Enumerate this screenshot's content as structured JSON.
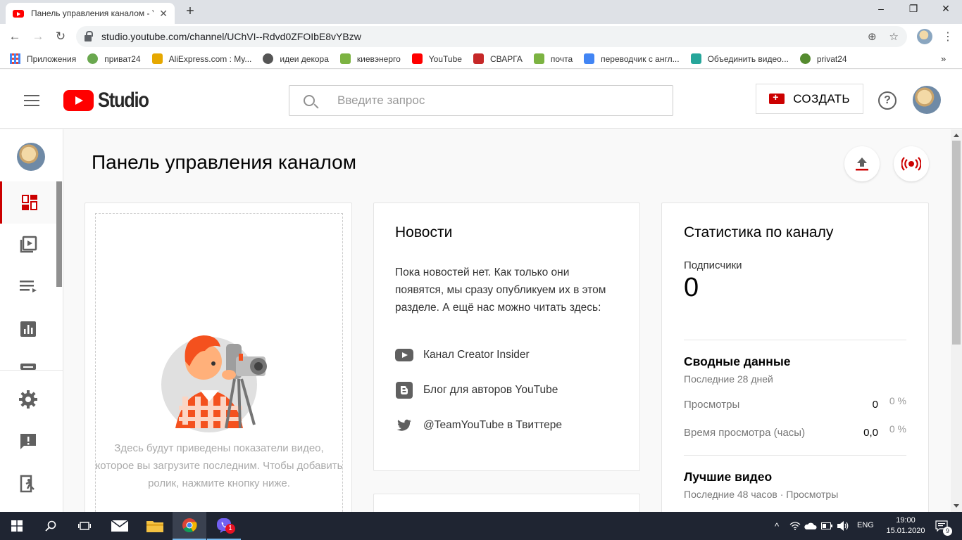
{
  "browser": {
    "tab_title": "Панель управления каналом - YouTube Studio",
    "url": "studio.youtube.com/channel/UChVI--Rdvd0ZFOIbE8vYBzw",
    "window_buttons": [
      "–",
      "❐",
      "✕"
    ]
  },
  "bookmarks": [
    {
      "label": "Приложения",
      "icon": "apps-grid-icon",
      "color": "#4285f4"
    },
    {
      "label": "приват24",
      "icon": "privat24-icon",
      "color": "#6aa84f"
    },
    {
      "label": "AliExpress.com : My...",
      "icon": "aliexpress-icon",
      "color": "#e6a800"
    },
    {
      "label": "идеи декора",
      "icon": "globe-icon",
      "color": "#555555"
    },
    {
      "label": "киевэнерго",
      "icon": "leaf-icon",
      "color": "#7cb342"
    },
    {
      "label": "YouTube",
      "icon": "youtube-icon",
      "color": "#ff0000"
    },
    {
      "label": "СВАРГА",
      "icon": "svarga-icon",
      "color": "#c62828"
    },
    {
      "label": "почта",
      "icon": "mail-icon",
      "color": "#7cb342"
    },
    {
      "label": "переводчик с англ...",
      "icon": "google-icon",
      "color": "#4285f4"
    },
    {
      "label": "Объединить видео...",
      "icon": "play-icon",
      "color": "#26a69a"
    },
    {
      "label": "privat24",
      "icon": "privat24-icon",
      "color": "#558b2f"
    }
  ],
  "header": {
    "logo_text": "Studio",
    "search_placeholder": "Введите запрос",
    "create_label": "СОЗДАТЬ",
    "help_glyph": "?"
  },
  "page": {
    "title": "Панель управления каналом"
  },
  "video_card": {
    "hint": "Здесь будут приведены показатели видео, которое вы загрузите последним. Чтобы добавить ролик, нажмите кнопку ниже."
  },
  "news": {
    "title": "Новости",
    "text": "Пока новостей нет. Как только они появятся, мы сразу опубликуем их в этом разделе. А ещё нас можно читать здесь:",
    "links": [
      {
        "label": "Канал Creator Insider",
        "icon": "youtube-icon"
      },
      {
        "label": "Блог для авторов YouTube",
        "icon": "blogger-icon"
      },
      {
        "label": "@TeamYouTube в Твиттере",
        "icon": "twitter-icon"
      }
    ]
  },
  "stats": {
    "title": "Статистика по каналу",
    "subscribers_label": "Подписчики",
    "subscribers_value": "0",
    "summary_title": "Сводные данные",
    "summary_period": "Последние 28 дней",
    "views_label": "Просмотры",
    "views_value": "0",
    "views_pct": "0 %",
    "watch_label": "Время просмотра (часы)",
    "watch_value": "0,0",
    "watch_pct": "0 %",
    "top_title": "Лучшие видео",
    "top_period": "Последние 48 часов · Просмотры"
  },
  "taskbar": {
    "lang": "ENG",
    "time": "19:00",
    "date": "15.01.2020",
    "viber_badge": "1",
    "notif_count": "9"
  },
  "colors": {
    "accent_red": "#cc0000",
    "youtube_red": "#ff0000",
    "taskbar": "#1f2532"
  }
}
